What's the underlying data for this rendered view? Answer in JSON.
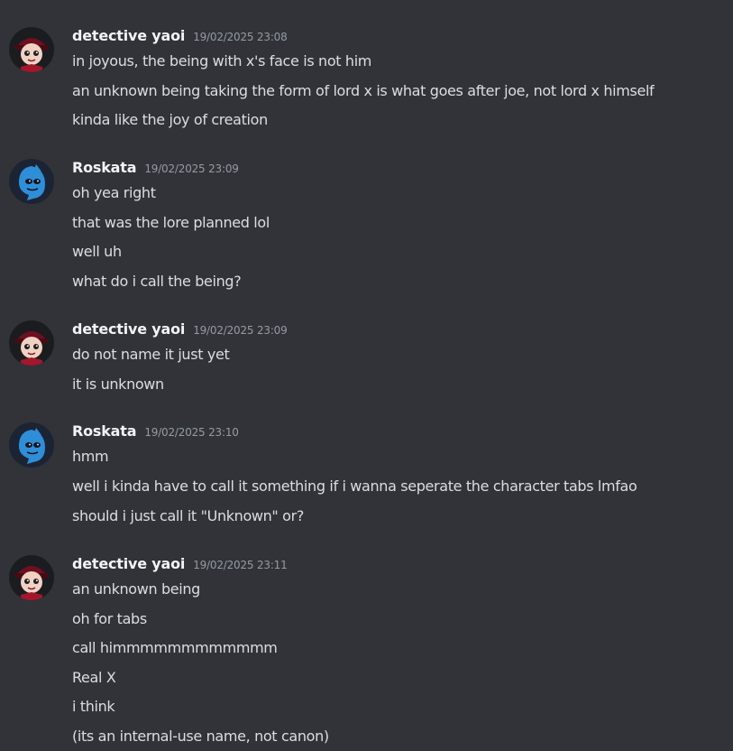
{
  "messages": [
    {
      "author": "detective yaoi",
      "timestamp": "19/02/2025 23:08",
      "avatar": "red-hat-character-avatar",
      "lines": [
        "in joyous, the being with x's face is not him",
        "an unknown being taking the form of lord x is what goes after joe, not lord x himself",
        "kinda like the joy of creation"
      ]
    },
    {
      "author": "Roskata",
      "timestamp": "19/02/2025 23:09",
      "avatar": "blue-character-avatar",
      "lines": [
        "oh yea right",
        "that was the lore planned lol",
        "well uh",
        "what do i call the being?"
      ]
    },
    {
      "author": "detective yaoi",
      "timestamp": "19/02/2025 23:09",
      "avatar": "red-hat-character-avatar",
      "lines": [
        "do not name it just yet",
        "it is unknown"
      ]
    },
    {
      "author": "Roskata",
      "timestamp": "19/02/2025 23:10",
      "avatar": "blue-character-avatar",
      "lines": [
        "hmm",
        "well i kinda have to call it something if i wanna seperate the character tabs lmfao",
        "should i just call it \"Unknown\" or?"
      ]
    },
    {
      "author": "detective yaoi",
      "timestamp": "19/02/2025 23:11",
      "avatar": "red-hat-character-avatar",
      "lines": [
        "an unknown being",
        "oh for tabs",
        "call himmmmmmmmmmmm",
        "Real X",
        "i think",
        "(its an internal-use name, not canon)"
      ]
    }
  ],
  "colors": {
    "background": "#313338",
    "text": "#dbdee1",
    "username": "#f2f3f5",
    "timestamp": "#949ba4"
  }
}
